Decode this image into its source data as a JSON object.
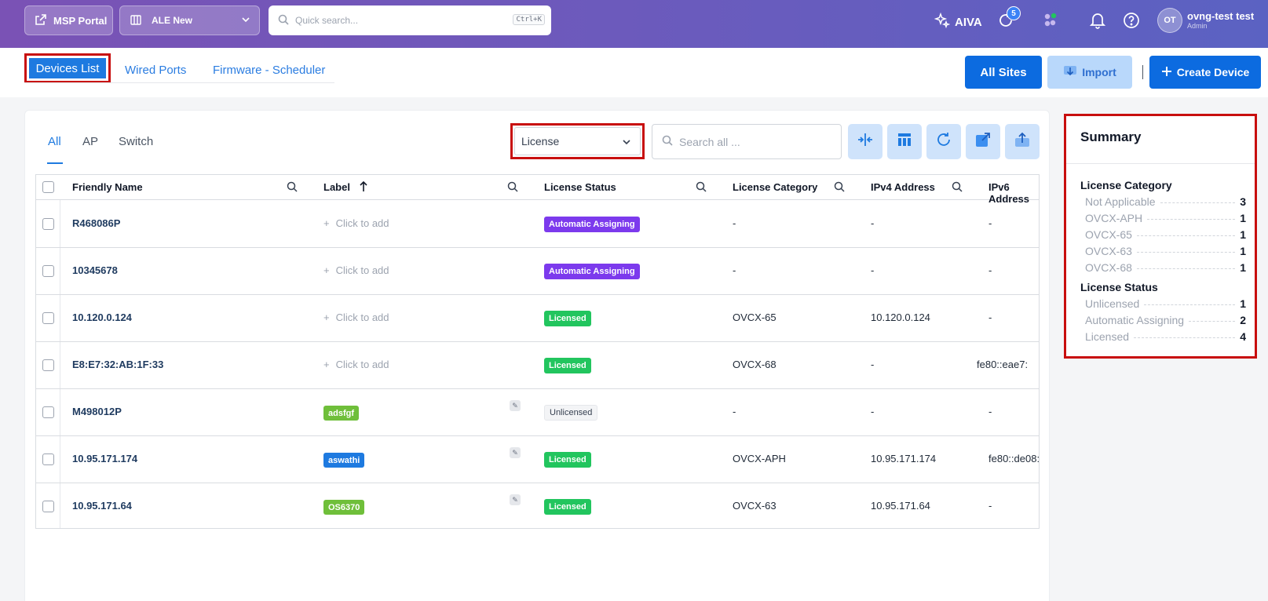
{
  "topbar": {
    "msp_label": "MSP Portal",
    "site_selector": "ALE New",
    "search_placeholder": "Quick search...",
    "search_shortcut": "Ctrl+K",
    "aiva_label": "AIVA",
    "tasks_badge": "5",
    "user_initials": "OT",
    "user_name": "ovng-test test",
    "user_role": "Admin",
    "accent": "#7a52b5"
  },
  "page_tabs": [
    "Devices List",
    "Wired Ports",
    "Firmware - Scheduler"
  ],
  "actions": {
    "all_sites": "All Sites",
    "import": "Import",
    "create_device": "Create Device"
  },
  "filters": {
    "tabs": [
      "All",
      "AP",
      "Switch"
    ],
    "column_group": "License",
    "search_placeholder": "Search all ..."
  },
  "table": {
    "headers": {
      "friendly_name": "Friendly Name",
      "label": "Label",
      "license_status": "License Status",
      "license_category": "License Category",
      "ipv4": "IPv4 Address",
      "ipv6": "IPv6 Address"
    },
    "add_label_text": "Click to add",
    "rows": [
      {
        "name": "R468086P",
        "label": "",
        "label_color": "",
        "status": "Automatic Assigning",
        "status_kind": "purple",
        "category": "-",
        "ipv4": "-",
        "ipv6": "-"
      },
      {
        "name": "10345678",
        "label": "",
        "label_color": "",
        "status": "Automatic Assigning",
        "status_kind": "purple",
        "category": "-",
        "ipv4": "-",
        "ipv6": "-"
      },
      {
        "name": "10.120.0.124",
        "label": "",
        "label_color": "",
        "status": "Licensed",
        "status_kind": "green",
        "category": "OVCX-65",
        "ipv4": "10.120.0.124",
        "ipv6": "-"
      },
      {
        "name": "E8:E7:32:AB:1F:33",
        "label": "",
        "label_color": "",
        "status": "Licensed",
        "status_kind": "green",
        "category": "OVCX-68",
        "ipv4": "-",
        "ipv6": "fe80::eae7:"
      },
      {
        "name": "M498012P",
        "label": "adsfgf",
        "label_color": "green",
        "status": "Unlicensed",
        "status_kind": "gray",
        "category": "-",
        "ipv4": "-",
        "ipv6": "-"
      },
      {
        "name": "10.95.171.174",
        "label": "aswathi",
        "label_color": "blue",
        "status": "Licensed",
        "status_kind": "green",
        "category": "OVCX-APH",
        "ipv4": "10.95.171.174",
        "ipv6": "fe80::de08:"
      },
      {
        "name": "10.95.171.64",
        "label": "OS6370",
        "label_color": "green",
        "status": "Licensed",
        "status_kind": "green",
        "category": "OVCX-63",
        "ipv4": "10.95.171.64",
        "ipv6": "-"
      }
    ]
  },
  "summary": {
    "title": "Summary",
    "category_heading": "License Category",
    "categories": [
      {
        "name": "Not Applicable",
        "count": "3"
      },
      {
        "name": "OVCX-APH",
        "count": "1"
      },
      {
        "name": "OVCX-65",
        "count": "1"
      },
      {
        "name": "OVCX-63",
        "count": "1"
      },
      {
        "name": "OVCX-68",
        "count": "1"
      }
    ],
    "status_heading": "License Status",
    "statuses": [
      {
        "name": "Unlicensed",
        "count": "1"
      },
      {
        "name": "Automatic Assigning",
        "count": "2"
      },
      {
        "name": "Licensed",
        "count": "4"
      }
    ]
  }
}
